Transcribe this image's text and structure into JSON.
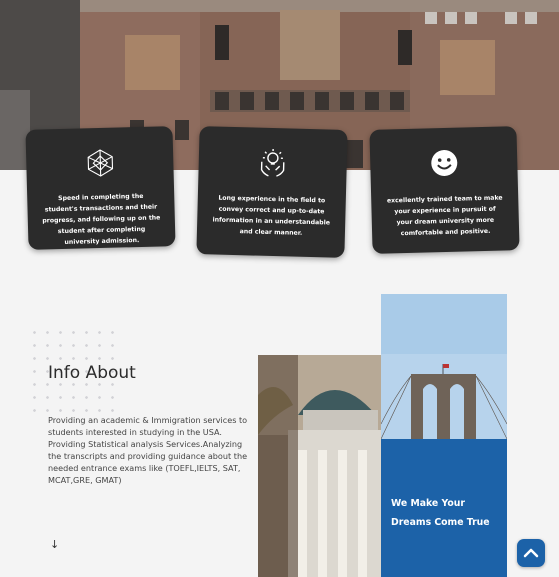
{
  "features": [
    {
      "icon": "diamond-mesh-icon",
      "text": "Speed in completing the student's transactions and their progress, and following up on the student after completing university admission."
    },
    {
      "icon": "hands-lightbulb-icon",
      "text": "Long experience in the field to convey correct and up-to-date information in an understandable and clear manner."
    },
    {
      "icon": "smile-icon",
      "text": "excellently trained team to make your experience in pursuit of your dream university more comfortable and positive."
    }
  ],
  "info": {
    "title": "Info About",
    "body": "Providing an academic & Immigration services to students interested in studying in the USA. Providing Statistical analysis Services.Analyzing the transcripts and providing guidance about the needed entrance exams like (TOEFL,IELTS, SAT, MCAT,GRE, GMAT)",
    "arrow": "↓"
  },
  "banner": {
    "text": "We Make Your Dreams Come True"
  },
  "colors": {
    "accent": "#1c62a8",
    "card": "#2b2b2b"
  }
}
